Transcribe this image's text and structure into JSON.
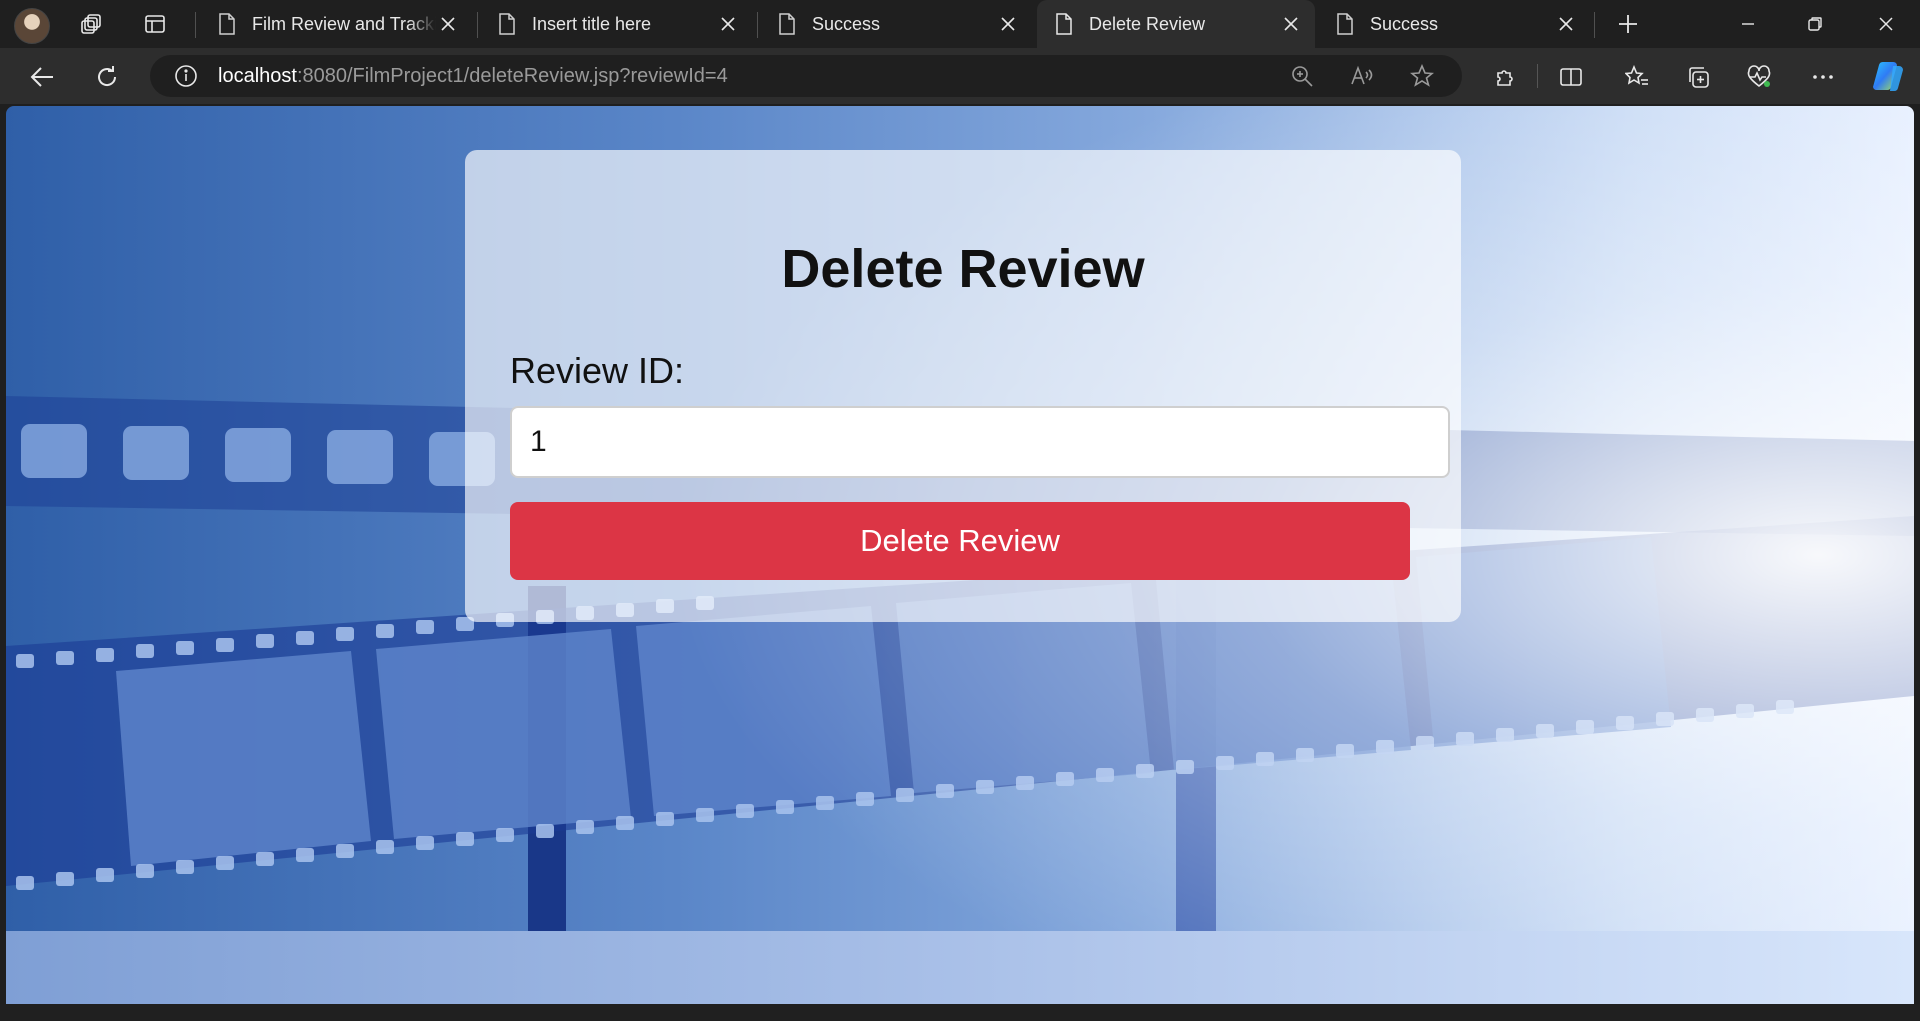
{
  "browser": {
    "tabs": [
      {
        "title": "Film Review and Tracking",
        "active": false
      },
      {
        "title": "Insert title here",
        "active": false
      },
      {
        "title": "Success",
        "active": false
      },
      {
        "title": "Delete Review",
        "active": true
      },
      {
        "title": "Success",
        "active": false
      }
    ],
    "address": {
      "host": "localhost",
      "path": ":8080/FilmProject1/deleteReview.jsp?reviewId=4"
    }
  },
  "page": {
    "heading": "Delete Review",
    "field_label": "Review ID:",
    "field_value": "1",
    "submit_label": "Delete Review",
    "submit_color": "#dc3545"
  }
}
